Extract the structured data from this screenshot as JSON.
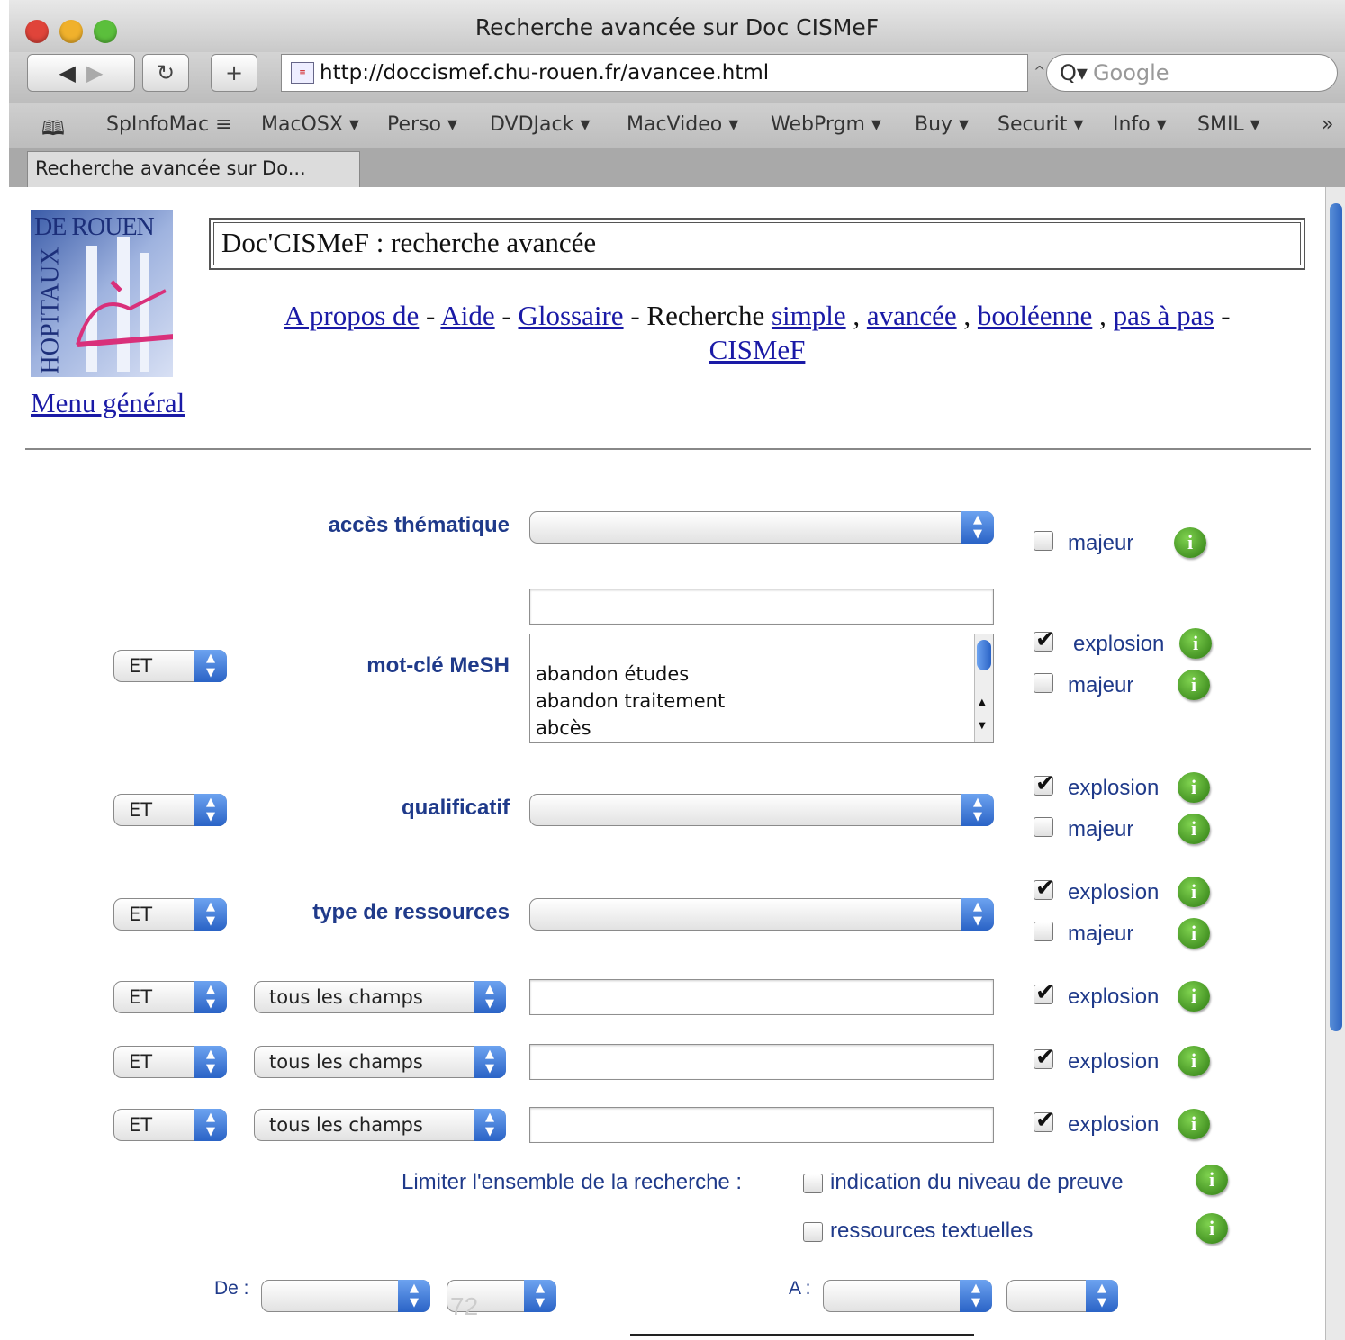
{
  "window": {
    "title": "Recherche avancée sur Doc CISMeF"
  },
  "toolbar": {
    "back_icon": "back-arrow-icon",
    "forward_icon": "forward-arrow-icon",
    "reload_icon": "reload-icon",
    "add_icon": "plus-icon",
    "url": "http://doccismef.chu-rouen.fr/avancee.html",
    "search_placeholder": "Google"
  },
  "bookmarks": {
    "book_icon": "bookmarks-book-icon",
    "items": [
      "SpInfoMac ≡",
      "MacOSX ▾",
      "Perso ▾",
      "DVDJack ▾",
      "MacVideo ▾",
      "WebPrgm ▾",
      "Buy ▾",
      "Securit ▾",
      "Info ▾",
      "SMIL ▾"
    ],
    "overflow": "»"
  },
  "tab": {
    "label": "Recherche avancée sur Do..."
  },
  "page": {
    "logo_top": "DE ROUEN",
    "logo_side": "HOPITAUX",
    "menu_link": "Menu général",
    "heading": "Doc'CISMeF : recherche avancée",
    "nav": {
      "about": "A propos de",
      "sep1": " - ",
      "help": "Aide",
      "sep2": " - ",
      "glossary": "Glossaire",
      "search_prefix": " - Recherche ",
      "simple": "simple",
      "c1": " , ",
      "advanced": "avancée",
      "c2": " , ",
      "boolean": "booléenne",
      "c3": " , ",
      "stepwise": "pas à pas",
      "sep3": " -",
      "cismef": "CISMeF"
    }
  },
  "form": {
    "thematic": {
      "label": "accès thématique",
      "majeur_label": "majeur",
      "majeur_checked": false
    },
    "mesh": {
      "operator": "ET",
      "label": "mot-clé MeSH",
      "input_value": "",
      "list": [
        "abandon études",
        "abandon traitement",
        "abcès"
      ],
      "explosion_label": "explosion",
      "explosion_checked": true,
      "majeur_label": "majeur",
      "majeur_checked": false
    },
    "qualifier": {
      "operator": "ET",
      "label": "qualificatif",
      "explosion_label": "explosion",
      "majeur_label": "majeur"
    },
    "resource_type": {
      "operator": "ET",
      "label": "type de ressources",
      "explosion_label": "explosion",
      "majeur_label": "majeur"
    },
    "free_rows": [
      {
        "operator": "ET",
        "field": "tous les champs",
        "value": "",
        "explosion_label": "explosion"
      },
      {
        "operator": "ET",
        "field": "tous les champs",
        "value": "",
        "explosion_label": "explosion"
      },
      {
        "operator": "ET",
        "field": "tous les champs",
        "value": "",
        "explosion_label": "explosion"
      }
    ],
    "limit": {
      "label": "Limiter l'ensemble de la recherche :",
      "option1": "indication du niveau de preuve",
      "option2": "ressources textuelles"
    },
    "date": {
      "from_label": "De :",
      "to_label": "A :"
    }
  },
  "footer": {
    "page_number": "72"
  },
  "colors": {
    "label_blue": "#1f3a8a",
    "link_blue": "#1a1aa6",
    "info_green": "#3a9a1a",
    "scroll_blue": "#2e66c2"
  }
}
